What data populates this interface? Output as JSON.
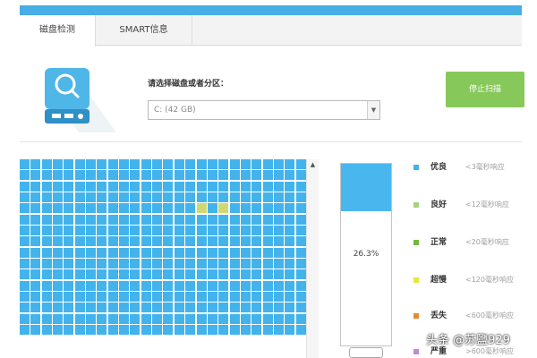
{
  "tabs": [
    {
      "label": "磁盘检测",
      "active": true
    },
    {
      "label": "SMART信息",
      "active": false
    }
  ],
  "disk_prompt": "请选择磁盘或者分区：",
  "disk_select": {
    "value": "C: (42 GB)"
  },
  "stop_button": "停止扫描",
  "progress": {
    "percent_text": "26.3%",
    "fill_fraction": 0.263
  },
  "grid": {
    "total_cells": 416,
    "good_cells": [
      120,
      122
    ],
    "colors": {
      "excellent": "#43b3ec",
      "good": "#cfd972"
    }
  },
  "legend": [
    {
      "label": "优良",
      "desc": "<3毫秒响应",
      "color": "#43b3ec"
    },
    {
      "label": "良好",
      "desc": "<12毫秒响应",
      "color": "#a8d27c"
    },
    {
      "label": "正常",
      "desc": "<20毫秒响应",
      "color": "#76b83a"
    },
    {
      "label": "超慢",
      "desc": "<120毫秒响应",
      "color": "#e6e83c"
    },
    {
      "label": "丢失",
      "desc": "<600毫秒响应",
      "color": "#e8892f"
    },
    {
      "label": "严重",
      "desc": ">600毫秒响应",
      "color": "#c08ad6"
    }
  ],
  "watermark": "头条 @苏鹽929",
  "icons": {
    "disk": "disk-magnifier-icon",
    "dropdown": "chevron-down-icon",
    "scroll_up": "scroll-up-arrow-icon"
  }
}
